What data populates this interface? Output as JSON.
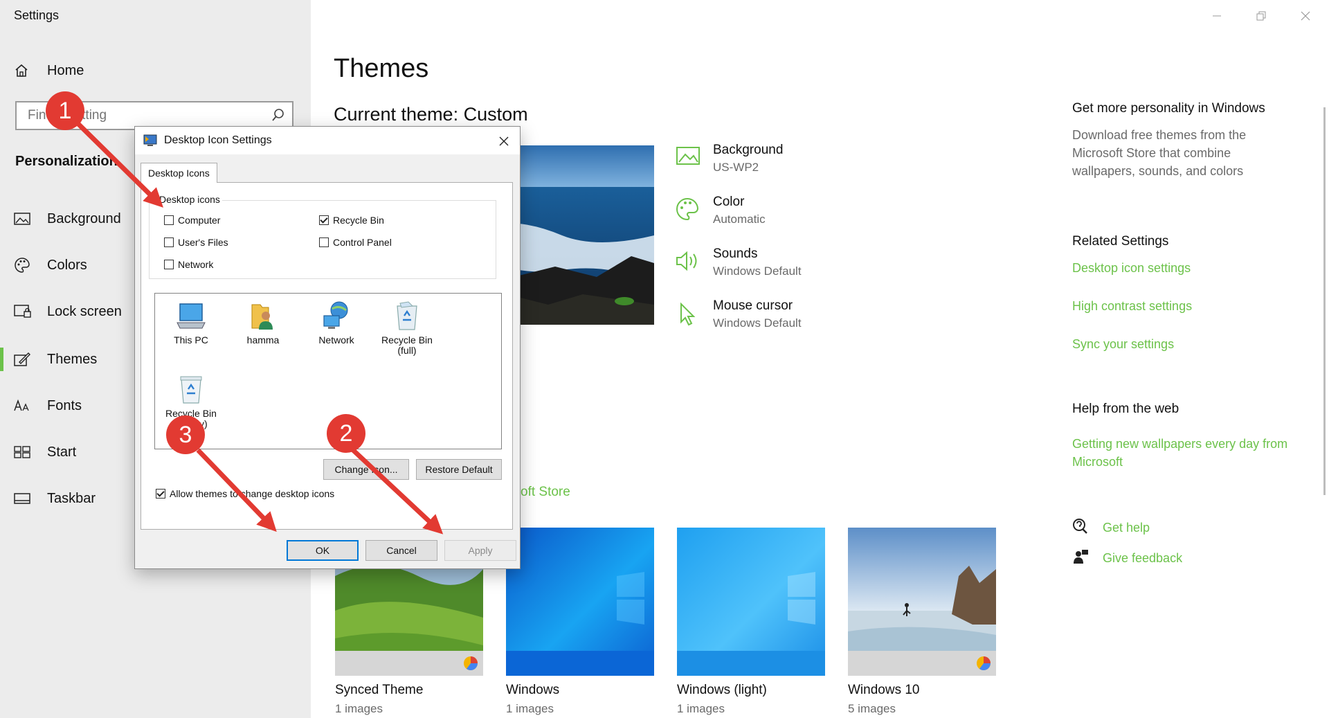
{
  "app": {
    "title": "Settings"
  },
  "sidebar": {
    "home_label": "Home",
    "search_placeholder": "Find a setting",
    "section_title": "Personalization",
    "items": [
      {
        "label": "Background",
        "icon": "picture-icon"
      },
      {
        "label": "Colors",
        "icon": "palette-icon"
      },
      {
        "label": "Lock screen",
        "icon": "lock-screen-icon"
      },
      {
        "label": "Themes",
        "icon": "brush-icon",
        "active": true
      },
      {
        "label": "Fonts",
        "icon": "font-icon"
      },
      {
        "label": "Start",
        "icon": "start-icon"
      },
      {
        "label": "Taskbar",
        "icon": "taskbar-icon"
      }
    ]
  },
  "main": {
    "title": "Themes",
    "current_theme": "Current theme: Custom",
    "properties": [
      {
        "name": "Background",
        "value": "US-WP2",
        "icon": "picture-icon"
      },
      {
        "name": "Color",
        "value": "Automatic",
        "icon": "palette-icon"
      },
      {
        "name": "Sounds",
        "value": "Windows Default",
        "icon": "speaker-icon"
      },
      {
        "name": "Mouse cursor",
        "value": "Windows Default",
        "icon": "cursor-icon"
      }
    ],
    "store_link_visible": "oft Store",
    "themes": [
      {
        "name": "Synced Theme",
        "count": "1 images"
      },
      {
        "name": "Windows",
        "count": "1 images"
      },
      {
        "name": "Windows (light)",
        "count": "1 images"
      },
      {
        "name": "Windows 10",
        "count": "5 images"
      }
    ]
  },
  "right": {
    "personality_title": "Get more personality in Windows",
    "personality_text": "Download free themes from the Microsoft Store that combine wallpapers, sounds, and colors",
    "related_title": "Related Settings",
    "related_links": [
      "Desktop icon settings",
      "High contrast settings",
      "Sync your settings"
    ],
    "help_title": "Help from the web",
    "help_link": "Getting new wallpapers every day from Microsoft",
    "get_help": "Get help",
    "give_feedback": "Give feedback"
  },
  "dialog": {
    "title": "Desktop Icon Settings",
    "tab": "Desktop Icons",
    "group_label": "Desktop icons",
    "checkboxes": [
      {
        "label": "Computer",
        "checked": false
      },
      {
        "label": "Recycle Bin",
        "checked": true
      },
      {
        "label": "User's Files",
        "checked": false
      },
      {
        "label": "Control Panel",
        "checked": false
      },
      {
        "label": "Network",
        "checked": false
      }
    ],
    "icons": [
      {
        "label": "This PC"
      },
      {
        "label": "hamma"
      },
      {
        "label": "Network"
      },
      {
        "label": "Recycle Bin (full)"
      },
      {
        "label": "Recycle Bin (empty)"
      }
    ],
    "change_icon_button": "Change Icon...",
    "restore_default_button": "Restore Default",
    "allow_themes": "Allow themes to change desktop icons",
    "allow_themes_checked": true,
    "ok": "OK",
    "cancel": "Cancel",
    "apply": "Apply"
  },
  "annotations": [
    "1",
    "2",
    "3"
  ],
  "colors": {
    "accent": "#6cc24a",
    "badge": "#e23a32",
    "focus": "#0078d7"
  }
}
